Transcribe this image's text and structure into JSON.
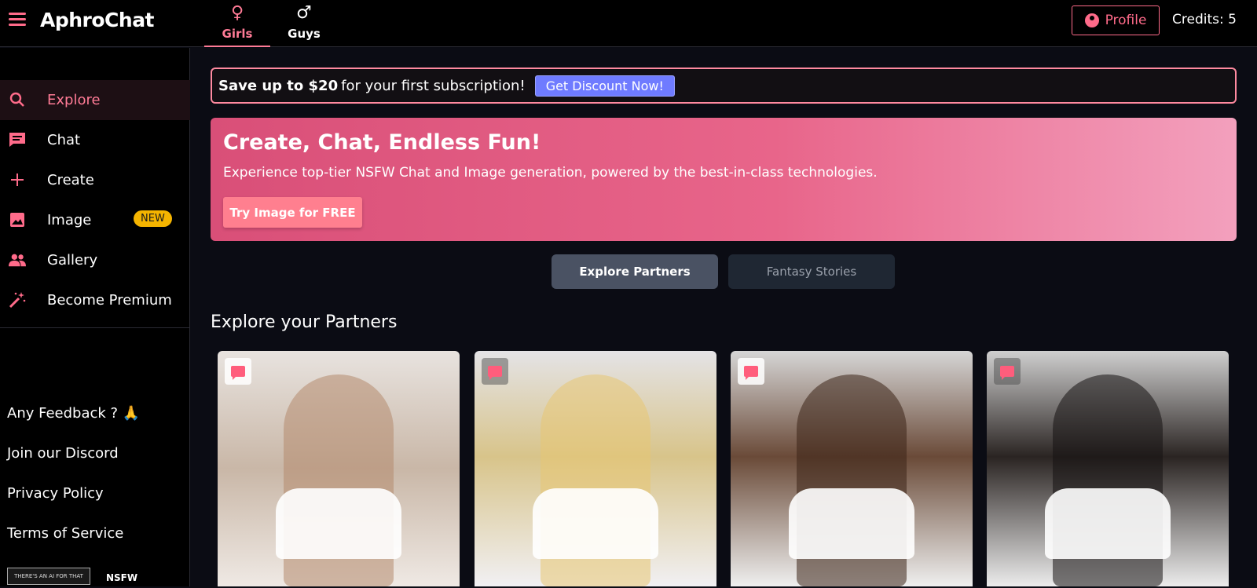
{
  "header": {
    "brand": "AphroChat",
    "tabs": [
      {
        "symbol": "♀",
        "label": "Girls"
      },
      {
        "symbol": "♂",
        "label": "Guys"
      }
    ],
    "profile_label": "Profile",
    "credits": "Credits: 5"
  },
  "sidebar": {
    "items": [
      {
        "icon": "search-icon",
        "label": "Explore"
      },
      {
        "icon": "chat-icon",
        "label": "Chat"
      },
      {
        "icon": "plus-icon",
        "label": "Create"
      },
      {
        "icon": "image-icon",
        "label": "Image",
        "badge": "NEW"
      },
      {
        "icon": "people-icon",
        "label": "Gallery"
      },
      {
        "icon": "magic-wand-icon",
        "label": "Become Premium"
      }
    ],
    "footer_links": [
      "Any Feedback ? 🙏",
      "Join our Discord",
      "Privacy Policy",
      "Terms of Service"
    ],
    "badges": [
      "THERE'S AN AI FOR THAT",
      "NSFW"
    ]
  },
  "promo": {
    "bold": "Save up to $20",
    "text": "for your first subscription!",
    "button": "Get Discount Now!"
  },
  "hero": {
    "title": "Create, Chat, Endless Fun!",
    "subtitle": "Experience top-tier NSFW Chat and Image generation, powered by the best-in-class technologies.",
    "button": "Try Image for FREE"
  },
  "segments": {
    "active": "Explore Partners",
    "inactive": "Fantasy Stories"
  },
  "section_title": "Explore your Partners",
  "colors": {
    "accent": "#ff6b8a",
    "hero_start": "#d94f78",
    "hero_end": "#f3a0bd",
    "discount": "#6f7bff",
    "badge_new": "#f5b400"
  }
}
